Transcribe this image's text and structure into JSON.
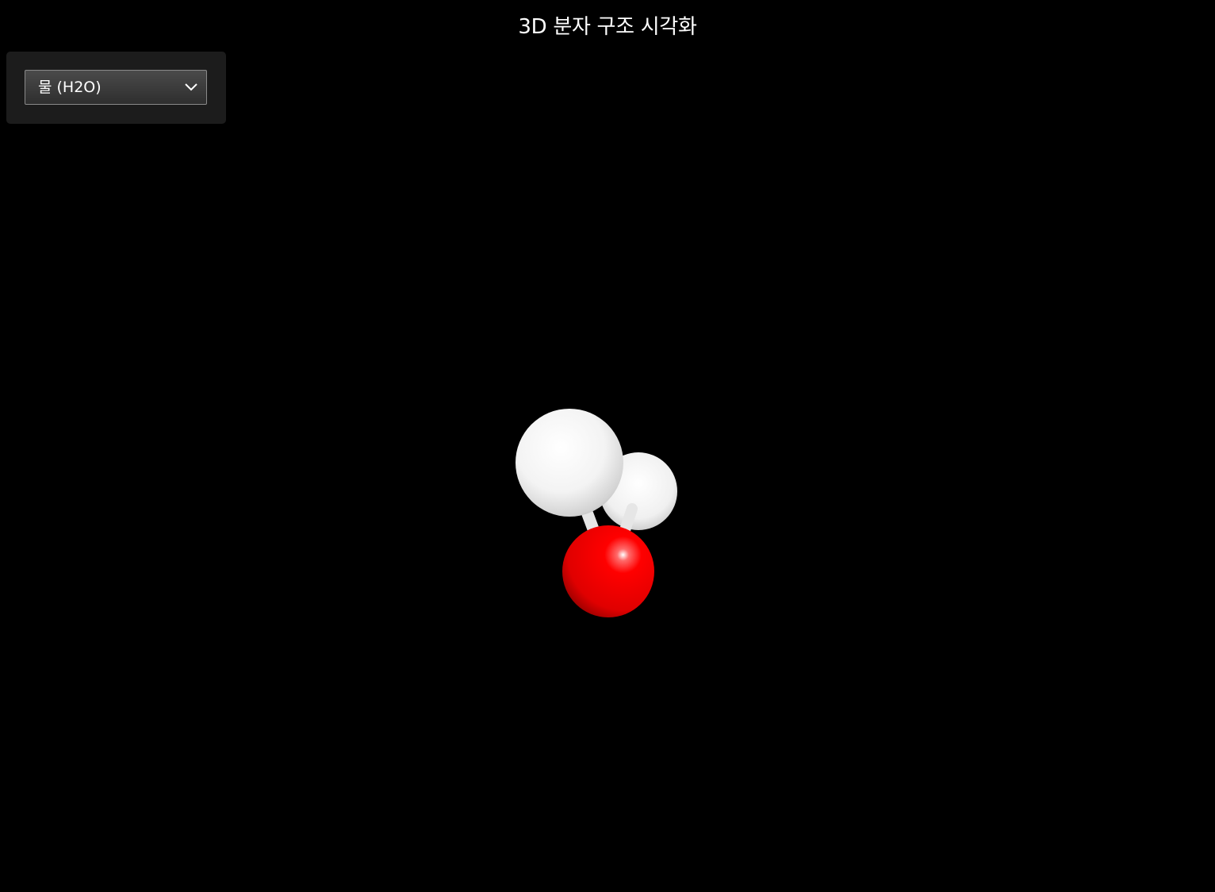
{
  "title": "3D 분자 구조 시각화",
  "molecule_select": {
    "selected": "물 (H2O)",
    "icon": "chevron-down-icon"
  },
  "molecule": {
    "atoms": [
      {
        "element": "H",
        "color": "#ffffff"
      },
      {
        "element": "H",
        "color": "#ffffff"
      },
      {
        "element": "O",
        "color": "#ff0000"
      }
    ],
    "bond_color": "#e8e8e8"
  },
  "colors": {
    "background": "#000000",
    "panel": "#1c1c1c",
    "oxygen": "#ff0000",
    "hydrogen": "#ffffff"
  }
}
